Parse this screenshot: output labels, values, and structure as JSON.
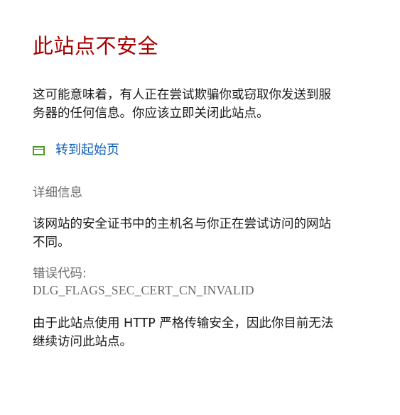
{
  "page": {
    "title": "此站点不安全",
    "description": "这可能意味着，有人正在尝试欺骗你或窃取你发送到服务器的任何信息。你应该立即关闭此站点。",
    "home_link": {
      "icon": "window-icon",
      "label": "转到起始页"
    },
    "details": {
      "heading": "详细信息",
      "mismatch_text": "该网站的安全证书中的主机名与你正在尝试访问的网站不同。",
      "error_label": "错误代码:",
      "error_code": "DLG_FLAGS_SEC_CERT_CN_INVALID",
      "hsts_text": "由于此站点使用 HTTP 严格传输安全，因此你目前无法继续访问此站点。"
    }
  },
  "colors": {
    "title": "#a70000",
    "link": "#0e5fb3",
    "icon": "#4c9a2a",
    "muted": "#6b6b6b",
    "body_text": "#1a1a1a"
  }
}
